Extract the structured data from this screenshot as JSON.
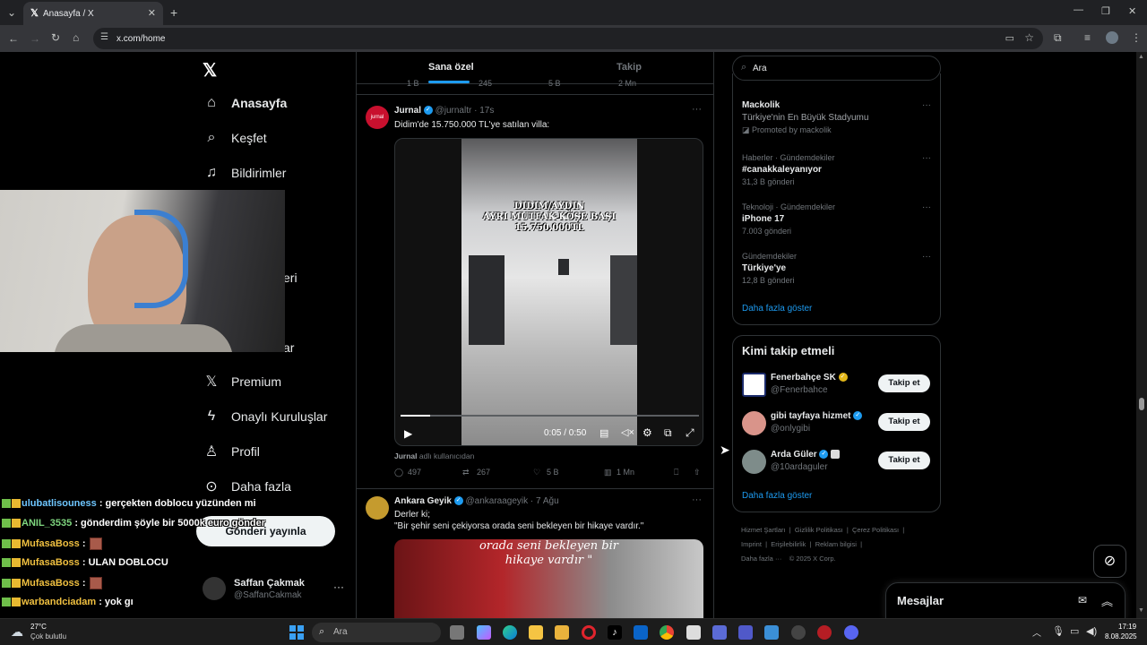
{
  "browser": {
    "tab_title": "Anasayfa / X",
    "url": "x.com/home"
  },
  "nav": {
    "items": [
      {
        "label": "Anasayfa",
        "icon": "home-icon"
      },
      {
        "label": "Keşfet",
        "icon": "search-icon"
      },
      {
        "label": "Bildirimler",
        "icon": "bell-icon"
      },
      {
        "label": "eri",
        "icon": "bookmark-icon"
      },
      {
        "label": "ar",
        "icon": "people-icon"
      },
      {
        "label": "Premium",
        "icon": "x-logo-icon"
      },
      {
        "label": "Onaylı Kuruluşlar",
        "icon": "lightning-icon"
      },
      {
        "label": "Profil",
        "icon": "person-icon"
      },
      {
        "label": "Daha fazla",
        "icon": "more-circle-icon"
      }
    ],
    "post_button": "Gönderi yayınla",
    "account_name": "Saffan Çakmak",
    "account_handle": "@SaffanCakmak"
  },
  "feed": {
    "tabs": [
      "Sana özel",
      "Takip"
    ],
    "prev_stats": [
      "1 B",
      "245",
      "5 B",
      "2 Mn"
    ],
    "tweet1": {
      "name": "Jurnal",
      "handle": "@jurnaltr",
      "time": "17s",
      "text": "Didim'de 15.750.000 TL'ye satılan villa:",
      "video_caption_1": "DIDIM/AYDIN",
      "video_caption_2": "AYRI MUTFAK-KÖŞE BAŞI",
      "video_caption_3": "15.750.000TL",
      "video_time": "0:05 / 0:50",
      "progress": 0.1,
      "source_name": "Jurnal",
      "source_suffix": "adlı kullanıcıdan",
      "stats": [
        "497",
        "267",
        "5 B",
        "1 Mn"
      ]
    },
    "tweet2": {
      "name": "Ankara Geyik",
      "handle": "@ankaraageyik",
      "time": "7 Ağu",
      "text_1": "Derler ki;",
      "text_2": "\"Bir şehir seni çekiyorsa orada seni bekleyen bir hikaye vardır.\"",
      "video_caption_1": "orada seni bekleyen bir",
      "video_caption_2": "hikaye vardır \""
    }
  },
  "sidebar": {
    "search_placeholder": "Ara",
    "trends": [
      {
        "meta": "",
        "name": "Mackolik",
        "sub": "Türkiye'nin En Büyük Stadyumu",
        "extra": "Promoted by mackolik"
      },
      {
        "meta": "Haberler · Gündemdekiler",
        "name": "#canakkaleyanıyor",
        "extra": "31,3 B gönderi"
      },
      {
        "meta": "Teknoloji · Gündemdekiler",
        "name": "iPhone 17",
        "extra": "7.003 gönderi"
      },
      {
        "meta": "Gündemdekiler",
        "name": "Türkiye'ye",
        "extra": "12,8 B gönderi"
      }
    ],
    "show_more": "Daha fazla göster",
    "who_to_follow_title": "Kimi takip etmeli",
    "follows": [
      {
        "name": "Fenerbahçe SK",
        "handle": "@Fenerbahce",
        "button": "Takip et"
      },
      {
        "name": "gibi tayfaya hizmet",
        "handle": "@onlygibi",
        "button": "Takip et"
      },
      {
        "name": "Arda Güler",
        "handle": "@10ardaguler",
        "button": "Takip et"
      }
    ],
    "follow_show_more": "Daha fazla göster",
    "footer": [
      "Hizmet Şartları",
      "Gizlilik Politikası",
      "Çerez Politikası",
      "Imprint",
      "Erişilebilirlik",
      "Reklam bilgisi",
      "Daha fazla ···",
      "© 2025 X Corp."
    ],
    "messages_label": "Mesajlar"
  },
  "chat": [
    {
      "user": "ulubatlisouness",
      "msg": ": gerçekten doblocu yüzünden mi",
      "color": "#6ec6ff"
    },
    {
      "user": "ANIL_3535",
      "msg": ": gönderdim şöyle bir 5000k euro gönder",
      "color": "#7fd67f"
    },
    {
      "user": "MufasaBoss",
      "msg": ":",
      "color": "#f0c040"
    },
    {
      "user": "MufasaBoss",
      "msg": ": ULAN DOBLOCU",
      "color": "#f0c040"
    },
    {
      "user": "MufasaBoss",
      "msg": ":",
      "color": "#f0c040"
    },
    {
      "user": "warbandciadam",
      "msg": ": yok gı",
      "color": "#f0c040"
    }
  ],
  "taskbar": {
    "weather_temp": "27°C",
    "weather_desc": "Çok bulutlu",
    "search_placeholder": "Ara",
    "time": "17:19",
    "date": "8.08.2025"
  }
}
